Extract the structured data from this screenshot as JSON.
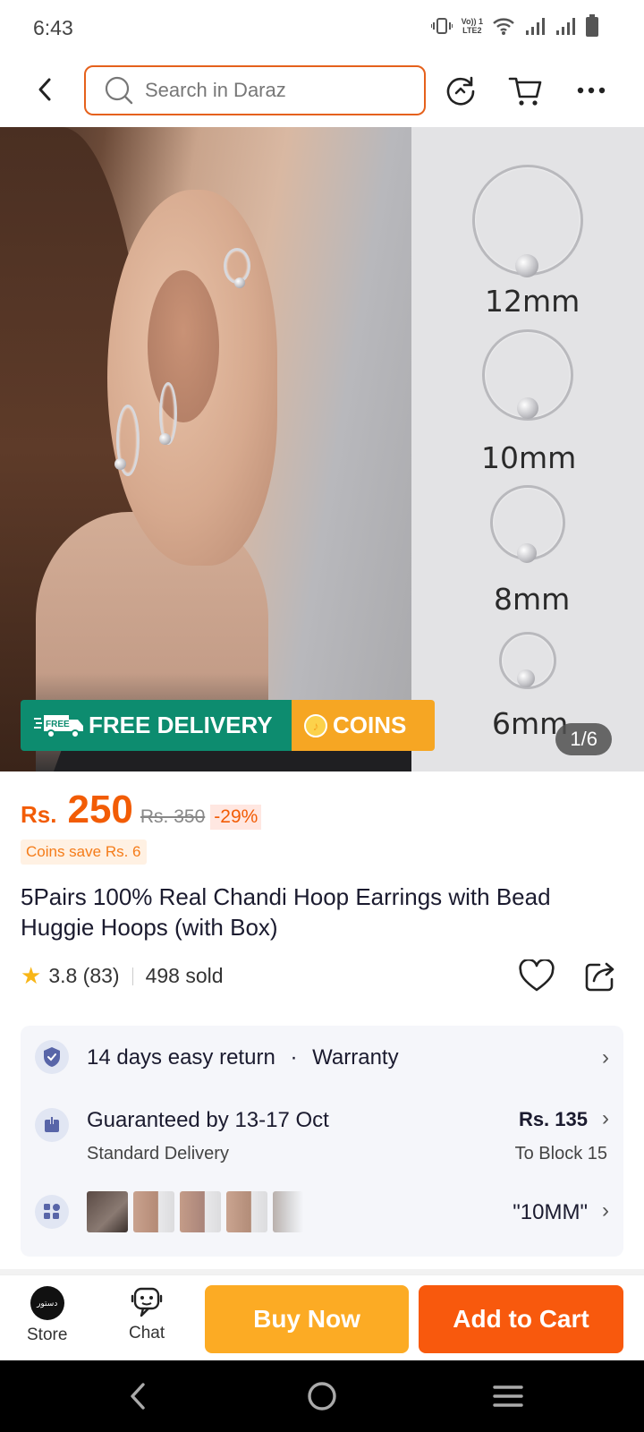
{
  "status": {
    "time": "6:43",
    "lte_top": "Vo)) 1",
    "lte_bottom": "LTE2"
  },
  "header": {
    "search_placeholder": "Search in Daraz"
  },
  "gallery": {
    "sizes": [
      "12mm",
      "10mm",
      "8mm",
      "6mm"
    ],
    "counter": "1/6",
    "promo_free": "FREE DELIVERY",
    "promo_free_tag": "FREE",
    "promo_coins": "COINS"
  },
  "price": {
    "currency": "Rs.",
    "value": "250",
    "original": "Rs. 350",
    "discount": "-29%",
    "coins_save": "Coins save Rs. 6"
  },
  "product": {
    "title": "5Pairs 100% Real Chandi Hoop Earrings with Bead Huggie Hoops (with Box)",
    "rating": "3.8 (83)",
    "sold": "498 sold"
  },
  "info": {
    "returns": "14 days easy return",
    "dot": "·",
    "warranty": "Warranty",
    "delivery_main": "Guaranteed by 13-17 Oct",
    "delivery_sub": "Standard Delivery",
    "delivery_price": "Rs. 135",
    "delivery_location": "To Block 15",
    "variant_selected": "\"10MM\""
  },
  "bottom": {
    "store_label": "Store",
    "chat_label": "Chat",
    "buy_now": "Buy Now",
    "add_to_cart": "Add to Cart",
    "store_logo_text": "دستور"
  },
  "colors": {
    "accent": "#f8590d",
    "buy": "#fcab24",
    "free_delivery": "#0d8c6f",
    "coins": "#f6a623"
  },
  "icons": [
    "back-icon",
    "search-icon",
    "history-icon",
    "cart-icon",
    "more-icon",
    "star-icon",
    "heart-icon",
    "share-icon",
    "shield-check-icon",
    "delivery-icon",
    "variants-icon",
    "chevron-right-icon",
    "chat-icon"
  ]
}
